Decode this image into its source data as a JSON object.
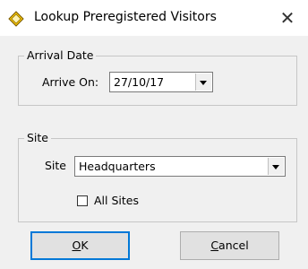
{
  "window": {
    "title": "Lookup Preregistered Visitors",
    "icon": "diamond-app-icon",
    "close_glyph": "✕"
  },
  "arrival_group": {
    "legend": "Arrival Date",
    "arrive_on_label": "Arrive On:",
    "date_value": "27/10/17"
  },
  "site_group": {
    "legend": "Site",
    "site_label": "Site",
    "site_value": "Headquarters",
    "all_sites_label": "All Sites",
    "all_sites_checked": false
  },
  "buttons": {
    "ok_mnemonic": "O",
    "ok_rest": "K",
    "cancel_mnemonic": "C",
    "cancel_rest": "ancel"
  },
  "colors": {
    "accent": "#0078d7",
    "icon_yellow": "#f2c200"
  }
}
